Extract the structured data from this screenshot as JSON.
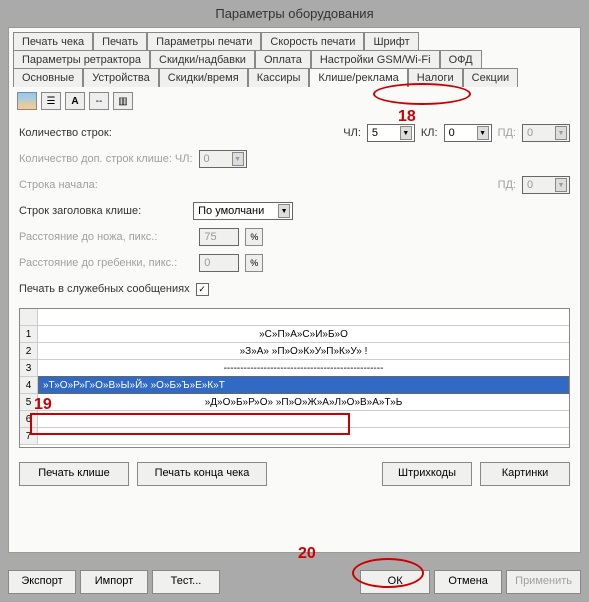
{
  "title": "Параметры оборудования",
  "tabs": {
    "r1": [
      "Печать чека",
      "Печать",
      "Параметры печати",
      "Скорость печати",
      "Шрифт"
    ],
    "r2": [
      "Параметры ретрактора",
      "Скидки/надбавки",
      "Оплата",
      "Настройки GSM/Wi-Fi",
      "ОФД"
    ],
    "r3": [
      "Основные",
      "Устройства",
      "Скидки/время",
      "Кассиры",
      "Клише/реклама",
      "Налоги",
      "Секции"
    ]
  },
  "active_tab": "Клише/реклама",
  "form": {
    "lines_label": "Количество строк:",
    "chl": "ЧЛ:",
    "chl_val": "5",
    "kl": "КЛ:",
    "kl_val": "0",
    "pd": "ПД:",
    "pd_val": "0",
    "extra_lines": "Количество доп. строк клише: ЧЛ:",
    "extra_val": "0",
    "start_line": "Строка начала:",
    "start_pd": "ПД:",
    "start_pd_val": "0",
    "header_lines": "Строк заголовка клише:",
    "header_val": "По умолчани",
    "knife_dist": "Расстояние до ножа, пикс.:",
    "knife_val": "75",
    "comb_dist": "Расстояние до гребенки, пикс.:",
    "comb_val": "0",
    "service_print": "Печать в служебных сообщениях"
  },
  "grid": [
    "»С»П»А»С»И»Б»О",
    "»З»А»   »П»О»К»У»П»К»У» !",
    "------------------------------------------------",
    "»Т»О»Р»Г»О»В»Ы»Й»   »О»Б»Ъ»Е»К»Т",
    "»Д»О»Б»Р»О»   »П»О»Ж»А»Л»О»В»А»Т»Ь"
  ],
  "btns": {
    "print_klishe": "Печать клише",
    "print_end": "Печать конца чека",
    "barcodes": "Штрихкоды",
    "pictures": "Картинки",
    "export": "Экспорт",
    "import": "Импорт",
    "test": "Тест...",
    "ok": "ОК",
    "cancel": "Отмена",
    "apply": "Применить"
  },
  "ann": {
    "a18": "18",
    "a19": "19",
    "a20": "20"
  }
}
